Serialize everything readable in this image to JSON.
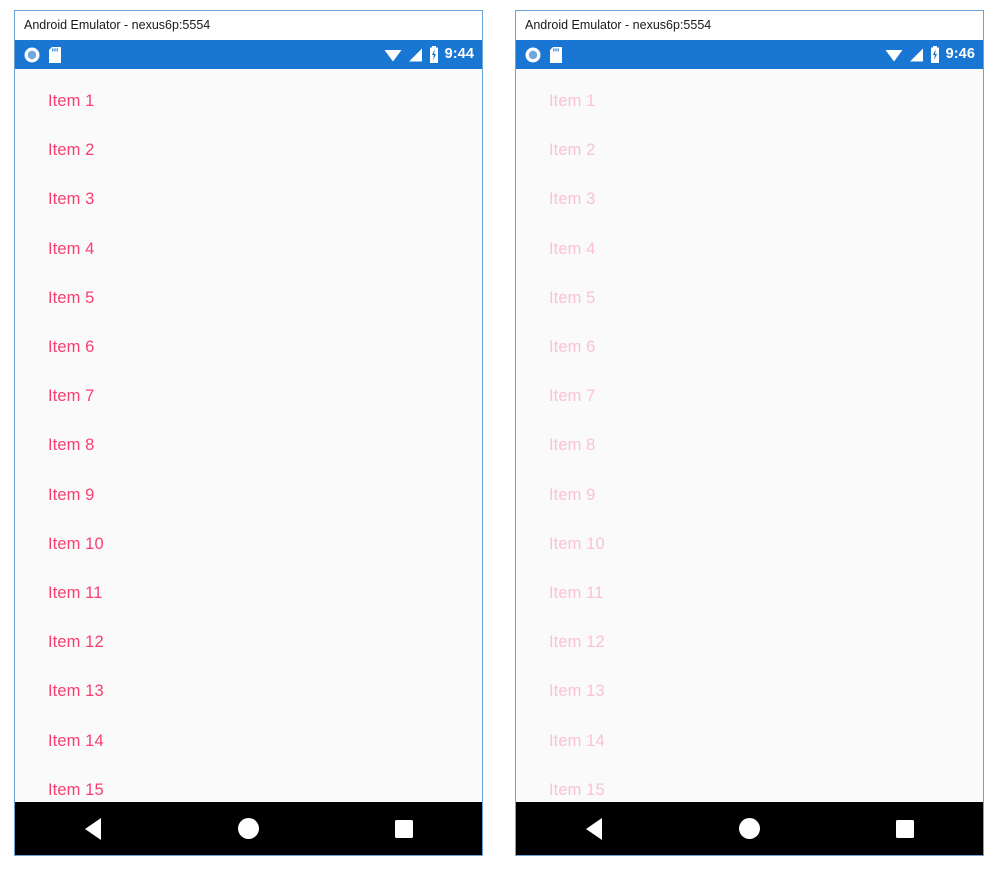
{
  "panels": [
    {
      "id": "left",
      "window_title": "Android Emulator - nexus6p:5554",
      "status_bar": {
        "clock": "9:44",
        "icons_left": [
          "record-icon",
          "sd-card-icon"
        ],
        "icons_right": [
          "wifi-icon",
          "signal-icon",
          "battery-icon"
        ],
        "background_color": "#1976D2"
      },
      "state": "loaded",
      "list_items": [
        "Item 1",
        "Item 2",
        "Item 3",
        "Item 4",
        "Item 5",
        "Item 6",
        "Item 7",
        "Item 8",
        "Item 9",
        "Item 10",
        "Item 11",
        "Item 12",
        "Item 13",
        "Item 14",
        "Item 15"
      ],
      "list_item_color": "#F73F71",
      "checkbox": {
        "checked": false,
        "label": ""
      },
      "spinner_visible": false,
      "nav_bar": [
        "back-button",
        "home-button",
        "recents-button"
      ]
    },
    {
      "id": "right",
      "window_title": "Android Emulator - nexus6p:5554",
      "status_bar": {
        "clock": "9:46",
        "icons_left": [
          "record-icon",
          "sd-card-icon"
        ],
        "icons_right": [
          "wifi-icon",
          "signal-icon",
          "battery-icon"
        ],
        "background_color": "#1976D2"
      },
      "state": "loading",
      "list_items": [
        "Item 1",
        "Item 2",
        "Item 3",
        "Item 4",
        "Item 5",
        "Item 6",
        "Item 7",
        "Item 8",
        "Item 9",
        "Item 10",
        "Item 11",
        "Item 12",
        "Item 13",
        "Item 14",
        "Item 15"
      ],
      "list_item_color": "#FAC3D2",
      "checkbox": {
        "checked": true,
        "label": ""
      },
      "spinner_visible": true,
      "spinner": {
        "type": "segmented-ring",
        "segments": 8,
        "colors": [
          "#7FE540",
          "#8CEC4C",
          "#95F049",
          "#8BEB43",
          "#76E22F",
          "#5CD70C",
          "#44CC00",
          "#62DC1F"
        ]
      },
      "nav_bar": [
        "back-button",
        "home-button",
        "recents-button"
      ]
    }
  ],
  "colors": {
    "window_border": "#6BA3D6",
    "status_bar": "#1976D2",
    "screen_background": "#FAFAFA",
    "nav_bar": "#000000",
    "accent_pink": "#F73F71",
    "spinner_green": "#7CE231"
  }
}
